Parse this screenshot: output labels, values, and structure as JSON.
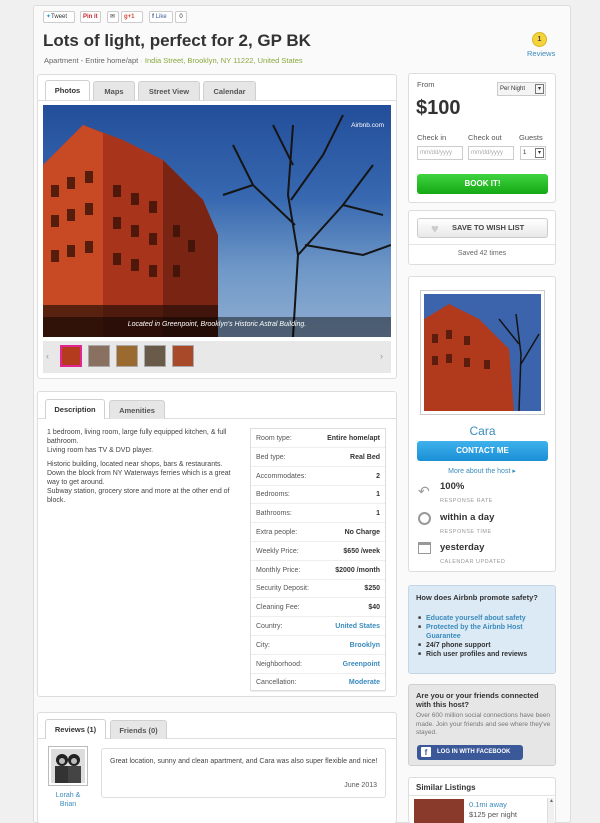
{
  "share": {
    "tweet": "Tweet",
    "pin": "Pin it",
    "gplus": "+1",
    "like": "Like",
    "like_count": "0"
  },
  "listing": {
    "title": "Lots of light, perfect for 2, GP BK",
    "room_type": "Apartment - Entire home/apt",
    "location": "India Street, Brooklyn, NY 11222, United States",
    "review_count": "1",
    "reviews_label": "Reviews"
  },
  "media_tabs": [
    "Photos",
    "Maps",
    "Street View",
    "Calendar"
  ],
  "photo": {
    "watermark": "Airbnb.com",
    "caption": "Located in Greenpoint, Brooklyn's Historic Astral Building."
  },
  "booking": {
    "from_label": "From",
    "period": "Per Night",
    "price": "$100",
    "checkin_label": "Check in",
    "checkout_label": "Check out",
    "guests_label": "Guests",
    "checkin_placeholder": "mm/dd/yyyy",
    "checkout_placeholder": "mm/dd/yyyy",
    "guests_value": "1",
    "book_button": "BOOK IT!"
  },
  "wishlist": {
    "button": "SAVE TO WISH LIST",
    "saved_text": "Saved 42 times"
  },
  "details_tabs": [
    "Description",
    "Amenities"
  ],
  "description": [
    "1 bedroom, living room, large fully equipped kitchen, & full",
    "bathroom.",
    "Living room has TV & DVD player.",
    "Historic building, located near shops, bars & restaurants.",
    "Down the block from NY Waterways ferries which is a great",
    "way to get around.",
    "Subway station, grocery store and more at the other end of",
    "block."
  ],
  "details": [
    {
      "key": "Room type:",
      "value": "Entire home/apt",
      "link": false
    },
    {
      "key": "Bed type:",
      "value": "Real Bed",
      "link": false
    },
    {
      "key": "Accommodates:",
      "value": "2",
      "link": false
    },
    {
      "key": "Bedrooms:",
      "value": "1",
      "link": false
    },
    {
      "key": "Bathrooms:",
      "value": "1",
      "link": false
    },
    {
      "key": "Extra people:",
      "value": "No Charge",
      "link": false
    },
    {
      "key": "Weekly Price:",
      "value": "$650 /week",
      "link": false
    },
    {
      "key": "Monthly Price:",
      "value": "$2000 /month",
      "link": false
    },
    {
      "key": "Security Deposit:",
      "value": "$250",
      "link": false
    },
    {
      "key": "Cleaning Fee:",
      "value": "$40",
      "link": false
    },
    {
      "key": "Country:",
      "value": "United States",
      "link": true
    },
    {
      "key": "City:",
      "value": "Brooklyn",
      "link": true
    },
    {
      "key": "Neighborhood:",
      "value": "Greenpoint",
      "link": true
    },
    {
      "key": "Cancellation:",
      "value": "Moderate",
      "link": true
    }
  ],
  "host": {
    "name": "Cara",
    "contact_button": "CONTACT ME",
    "more_link": "More about the host ▸",
    "response_rate": "100%",
    "response_rate_label": "RESPONSE RATE",
    "response_time": "within a day",
    "response_time_label": "RESPONSE TIME",
    "calendar_updated": "yesterday",
    "calendar_updated_label": "CALENDAR UPDATED"
  },
  "promote": {
    "title": "How does Airbnb promote safety?",
    "items": [
      "Educate yourself about safety",
      "Protected by the Airbnb Host Guarantee",
      "24/7 phone support",
      "Rich user profiles and reviews"
    ]
  },
  "connected": {
    "title": "Are you or your friends connected with this host?",
    "text": "Over 600 million social connections have been made. Join your friends and see where they've stayed.",
    "fb_button": "LOG IN WITH FACEBOOK"
  },
  "similar": {
    "title": "Similar Listings",
    "distance": "0.1mi away",
    "price": "$125 per night"
  },
  "review_tabs": [
    "Reviews (1)",
    "Friends (0)"
  ],
  "review": {
    "author": "Lorah & Brian",
    "text": "Great location, sunny and clean apartment, and Cara was also super flexible and nice!",
    "date": "June 2013"
  },
  "colors": {
    "link": "#3a8bbd",
    "book": "#22b822",
    "contact": "#2a9fe0",
    "location": "#8aa83e"
  }
}
